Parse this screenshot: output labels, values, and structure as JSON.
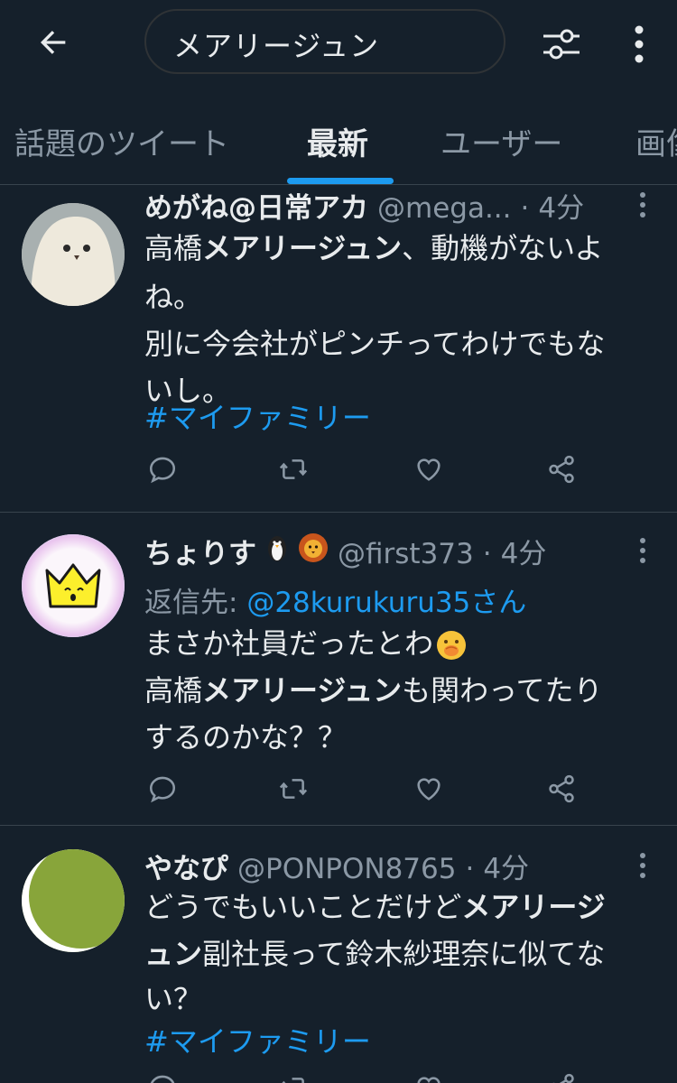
{
  "search": {
    "query": "メアリージュン"
  },
  "tabs": [
    {
      "label": "話題のツイート"
    },
    {
      "label": "最新"
    },
    {
      "label": "ユーザー"
    },
    {
      "label": "画像"
    }
  ],
  "tweets": [
    {
      "name": "めがね@日常アカ",
      "handle": "@mega...",
      "time": "4分",
      "lines": [
        {
          "pre": "高橋",
          "bold": "メアリージュン",
          "post": "、動機がないよ"
        },
        {
          "pre": "ね。",
          "bold": "",
          "post": ""
        },
        {
          "pre": "別に今会社がピンチってわけでもな",
          "bold": "",
          "post": ""
        },
        {
          "pre": "いし。",
          "bold": "",
          "post": ""
        }
      ],
      "hashtag": "#マイファミリー"
    },
    {
      "name": "ちょりす",
      "handle": "@first373",
      "time": "4分",
      "reply_label": "返信先: ",
      "reply_to": "@28kurukuru35さん",
      "lines": [
        {
          "pre": "まさか社員だったとわ",
          "bold": "",
          "post": ""
        },
        {
          "pre": "高橋",
          "bold": "メアリージュン",
          "post": "も関わってたり"
        },
        {
          "pre": "するのかな？？",
          "bold": "",
          "post": ""
        }
      ]
    },
    {
      "name": "やなぴ",
      "handle": "@PONPON8765",
      "time": "4分",
      "lines": [
        {
          "pre": "どうでもいいことだけど",
          "bold": "メアリージ",
          "post": ""
        },
        {
          "pre": "",
          "bold": "ュン",
          "post": "副社長って鈴木紗理奈に似てな"
        },
        {
          "pre": "い？",
          "bold": "",
          "post": ""
        }
      ],
      "hashtag": "#マイファミリー"
    }
  ],
  "colors": {
    "background": "#15202b",
    "accent": "#1d9bf0",
    "text": "#e8ebed",
    "muted": "#8b98a5",
    "border": "#38444d"
  }
}
